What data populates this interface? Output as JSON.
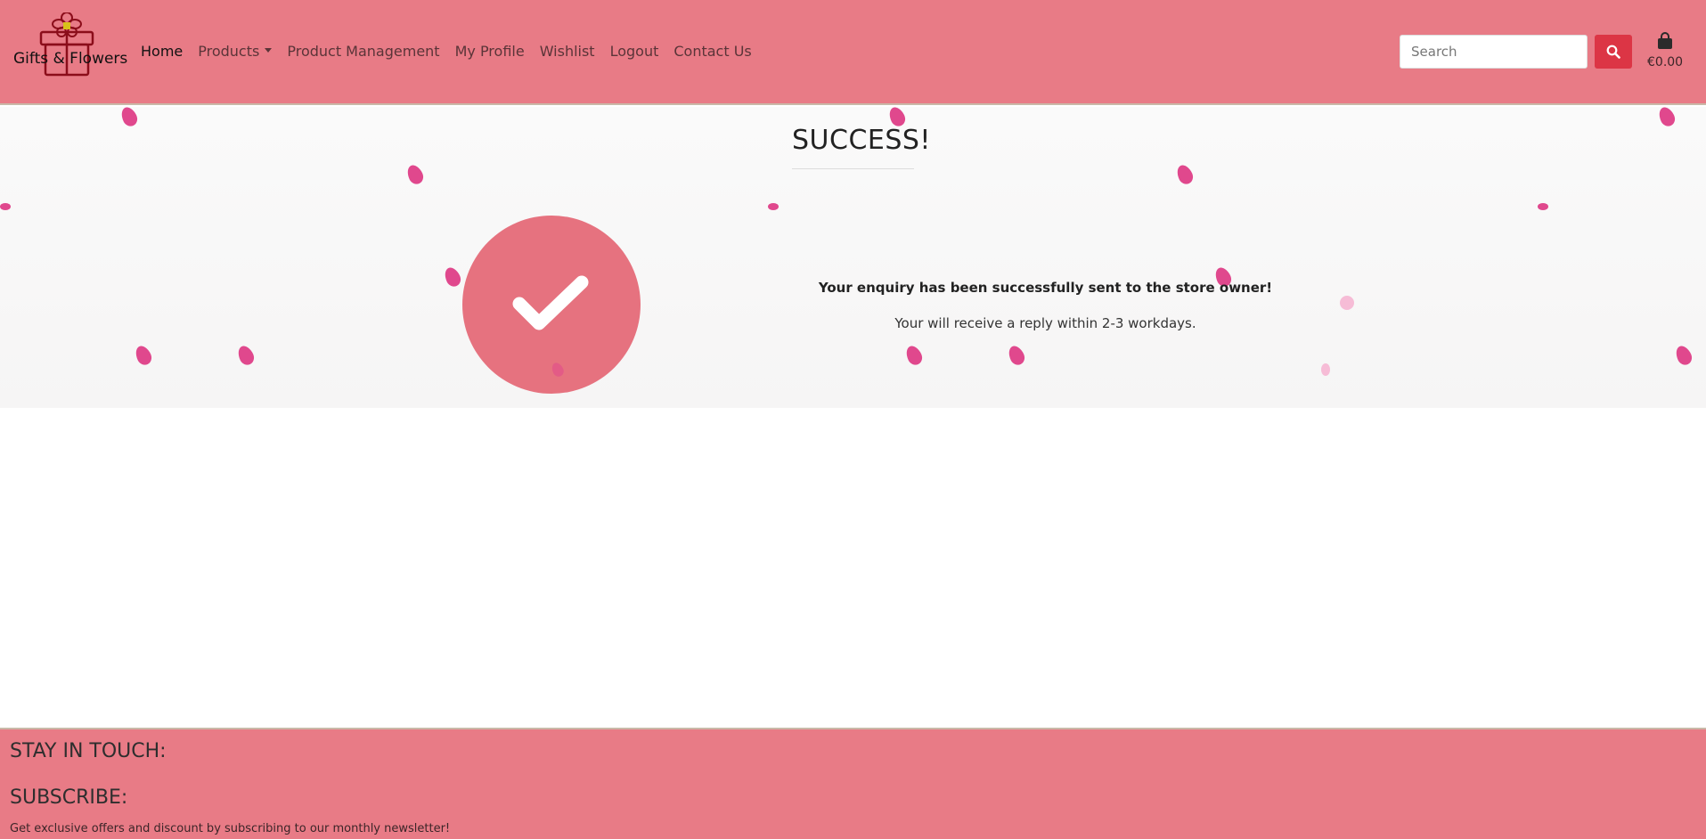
{
  "brand": {
    "name": "Gifts & Flowers",
    "logo_icon": "gift-box-flower-icon"
  },
  "nav": {
    "items": [
      {
        "label": "Home",
        "active": true
      },
      {
        "label": "Products",
        "dropdown": true
      },
      {
        "label": "Product Management"
      },
      {
        "label": "My Profile"
      },
      {
        "label": "Wishlist"
      },
      {
        "label": "Logout"
      },
      {
        "label": "Contact Us"
      }
    ]
  },
  "search": {
    "placeholder": "Search",
    "value": "",
    "button_icon": "search-icon"
  },
  "bag": {
    "icon": "shopping-bag-icon",
    "total": "€0.00"
  },
  "main": {
    "title": "SUCCESS!",
    "status_icon": "check-icon",
    "message_strong": "Your enquiry has been successfully sent to the store owner!",
    "message_sub": "Your will receive a reply within 2-3 workdays."
  },
  "footer": {
    "stay_heading": "STAY IN TOUCH:",
    "subscribe_heading": "SUBSCRIBE:",
    "subscribe_text": "Get exclusive offers and discount by subscribing to our monthly newsletter!"
  },
  "colors": {
    "header_bg": "#e87b86",
    "accent_red": "#dc3545",
    "check_circle": "#e6727f",
    "petal": "#e0488d"
  }
}
